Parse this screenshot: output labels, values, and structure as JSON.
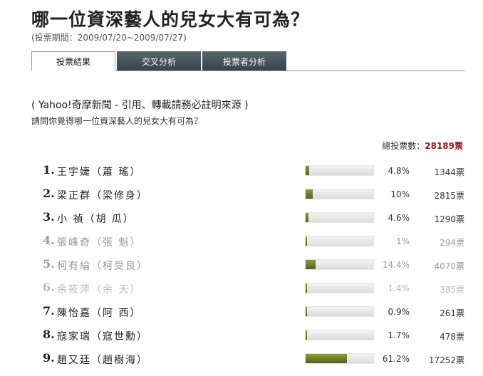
{
  "header": {
    "title": "哪一位資深藝人的兒女大有可為？",
    "period": "(投票期間：2009/07/20~2009/07/27)"
  },
  "tabs": [
    {
      "label": "投票結果",
      "active": true
    },
    {
      "label": "交叉分析",
      "active": false
    },
    {
      "label": "投票者分析",
      "active": false
    }
  ],
  "poll": {
    "source": "( Yahoo!奇摩新聞 - 引用、轉載請務必註明來源 )",
    "question": "請問你覺得哪一位資深藝人的兒女大有可為？",
    "total_label": "總投票數：",
    "total_value": "28189票",
    "bar_color": "#556418",
    "options": [
      {
        "rank": "1.",
        "name": "王宇婕（蕭 瑤）",
        "percent_text": "4.8%",
        "percent": 4.8,
        "votes": "1344票"
      },
      {
        "rank": "2.",
        "name": "梁正群（梁修身）",
        "percent_text": "10%",
        "percent": 10,
        "votes": "2815票"
      },
      {
        "rank": "3.",
        "name": "小 禎（胡 瓜）",
        "percent_text": "4.6%",
        "percent": 4.6,
        "votes": "1290票"
      },
      {
        "rank": "4.",
        "name": "張峰奇（張 魁）",
        "percent_text": "1%",
        "percent": 1,
        "votes": "294票"
      },
      {
        "rank": "5.",
        "name": "柯有綸（柯受良）",
        "percent_text": "14.4%",
        "percent": 14.4,
        "votes": "4070票"
      },
      {
        "rank": "6.",
        "name": "余筱萍（余 天）",
        "percent_text": "1.4%",
        "percent": 1.4,
        "votes": "385票"
      },
      {
        "rank": "7.",
        "name": "陳怡嘉（阿 西）",
        "percent_text": "0.9%",
        "percent": 0.9,
        "votes": "261票"
      },
      {
        "rank": "8.",
        "name": "寇家瑞（寇世勳）",
        "percent_text": "1.7%",
        "percent": 1.7,
        "votes": "478票"
      },
      {
        "rank": "9.",
        "name": "趙又廷（趙樹海）",
        "percent_text": "61.2%",
        "percent": 61.2,
        "votes": "17252票"
      }
    ]
  }
}
